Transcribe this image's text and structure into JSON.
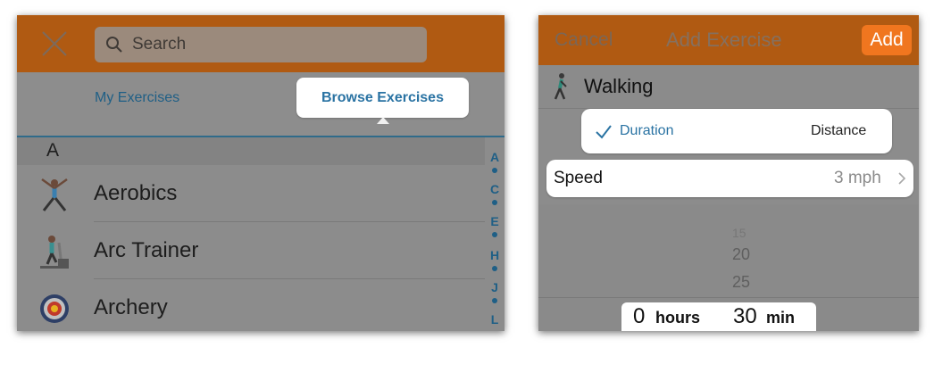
{
  "left": {
    "search_placeholder": "Search",
    "tabs": {
      "my": "My Exercises",
      "browse": "Browse Exercises"
    },
    "section_letter": "A",
    "exercises": [
      {
        "label": "Aerobics",
        "icon": "aerobics-figure-icon"
      },
      {
        "label": "Arc Trainer",
        "icon": "arc-trainer-icon"
      },
      {
        "label": "Archery",
        "icon": "archery-target-icon"
      }
    ],
    "index": [
      "A",
      "C",
      "E",
      "H",
      "J",
      "L"
    ]
  },
  "right": {
    "cancel": "Cancel",
    "title": "Add Exercise",
    "add": "Add",
    "activity": "Walking",
    "segments": {
      "duration": "Duration",
      "distance": "Distance",
      "selected": "duration"
    },
    "speed_label": "Speed",
    "speed_value": "3 mph",
    "picker": {
      "minutes_above": [
        "15",
        "20",
        "25"
      ],
      "hours_value": "0",
      "hours_unit": "hours",
      "minutes_value": "30",
      "minutes_unit": "min"
    }
  },
  "colors": {
    "header": "#b05a12",
    "accent_blue": "#2a73a3",
    "add_button": "#f0761f",
    "overlay_gray": "#8c8c8c"
  }
}
